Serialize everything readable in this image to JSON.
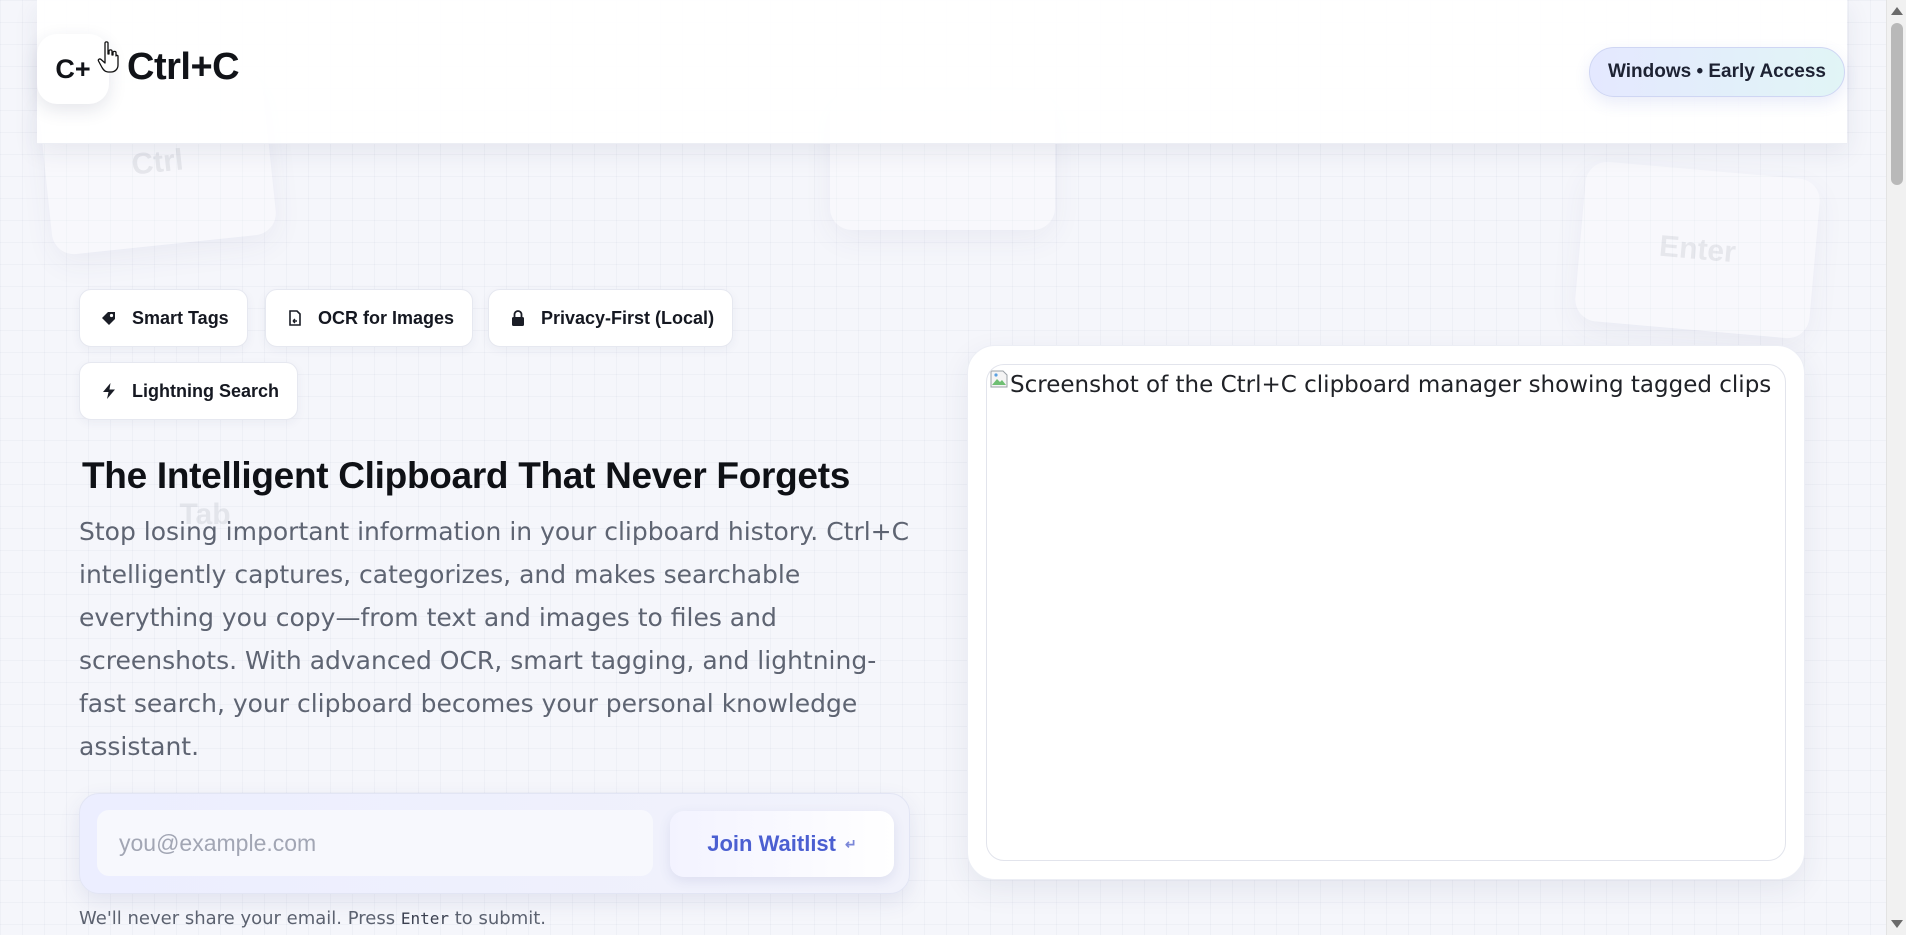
{
  "header": {
    "logo_mark": "C+",
    "brand_name": "Ctrl+C",
    "badge": "Windows • Early Access"
  },
  "background_keys": [
    "Ctrl",
    "Enter",
    "Tab"
  ],
  "features": [
    {
      "label": "Smart Tags",
      "icon": "tag-icon"
    },
    {
      "label": "OCR for Images",
      "icon": "ocr-icon"
    },
    {
      "label": "Privacy-First (Local)",
      "icon": "lock-icon"
    },
    {
      "label": "Lightning Search",
      "icon": "lightning-icon"
    }
  ],
  "hero": {
    "headline": "The Intelligent Clipboard That Never Forgets",
    "lede": "Stop losing important information in your clipboard history. Ctrl+C intelligently captures, categorizes, and makes searchable everything you copy—from text and images to files and screenshots. With advanced OCR, smart tagging, and lightning-fast search, your clipboard becomes your personal knowledge assistant."
  },
  "waitlist": {
    "email_placeholder": "you@example.com",
    "email_value": "",
    "button_label": "Join Waitlist",
    "button_glyph": "↵",
    "note_before": "We'll never share your email. Press ",
    "note_key": "Enter",
    "note_after": " to submit."
  },
  "preview": {
    "image_alt": "Screenshot of the Ctrl+C clipboard manager showing tagged clips"
  },
  "colors": {
    "accent": "#4b5fd1",
    "background": "#f5f6fb",
    "text": "#111318",
    "muted": "#5e6472"
  }
}
